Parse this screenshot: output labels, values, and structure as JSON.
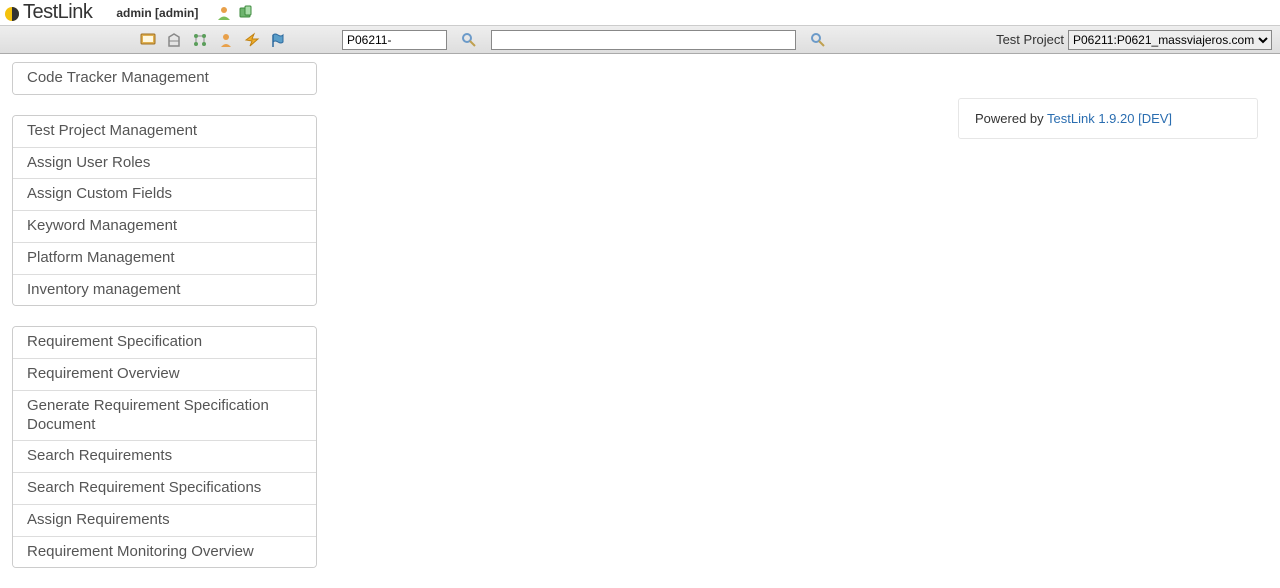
{
  "header": {
    "app_name": "TestLink",
    "user_label": "admin [admin]"
  },
  "toolbar": {
    "tc_search_value": "P06211-",
    "big_search_value": "",
    "project_label": "Test Project",
    "project_selected": "P06211:P0621_massviajeros.com"
  },
  "sidebar": {
    "group1": [
      "Code Tracker Management"
    ],
    "group2": [
      "Test Project Management",
      "Assign User Roles",
      "Assign Custom Fields",
      "Keyword Management",
      "Platform Management",
      "Inventory management"
    ],
    "group3": [
      "Requirement Specification",
      "Requirement Overview",
      "Generate Requirement Specification Document",
      "Search Requirements",
      "Search Requirement Specifications",
      "Assign Requirements",
      "Requirement Monitoring Overview"
    ]
  },
  "footer": {
    "powered_label": "Powered by ",
    "powered_link": "TestLink 1.9.20 [DEV]"
  }
}
